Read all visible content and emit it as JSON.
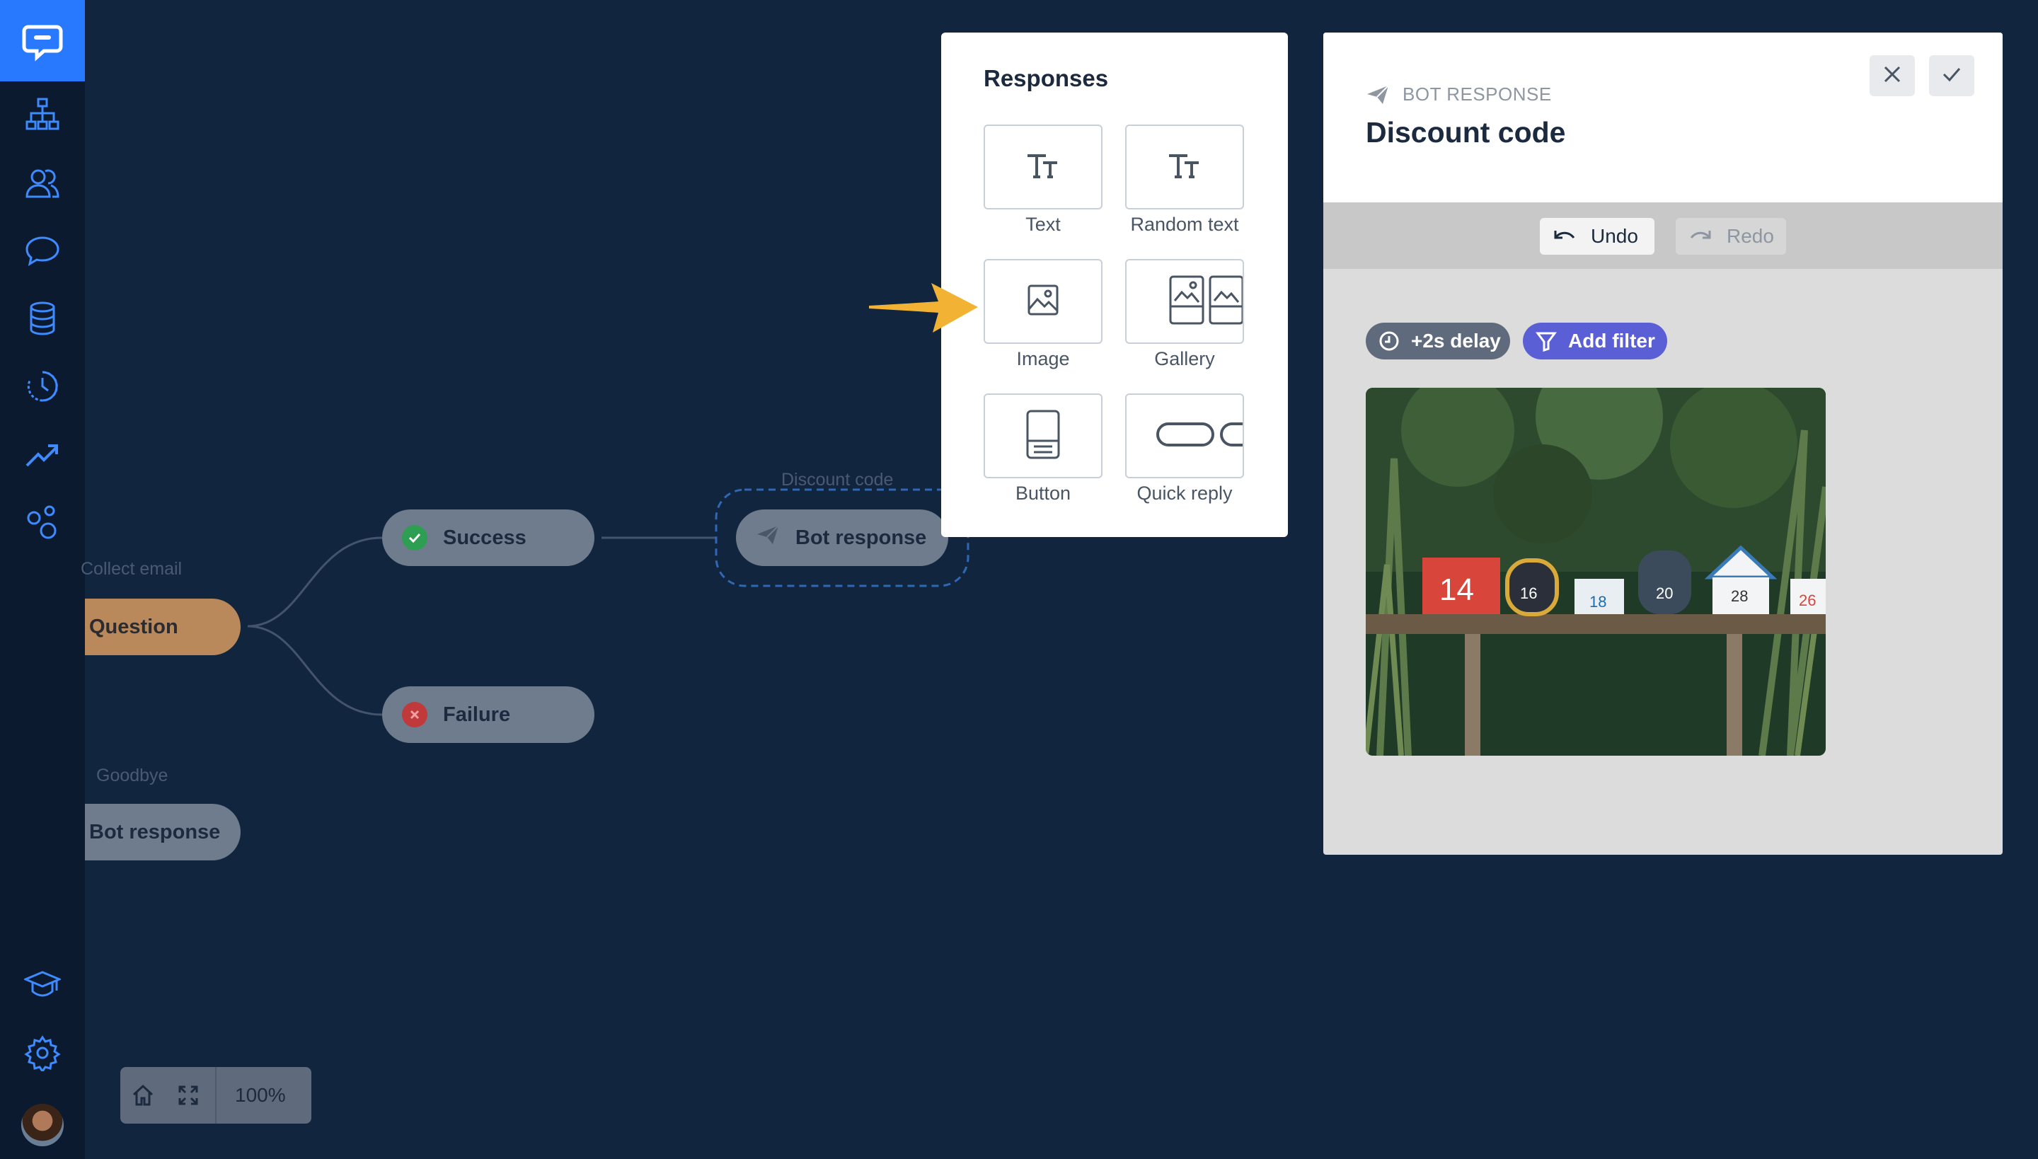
{
  "sidebar": {
    "items": [
      "logo-chat-icon",
      "flow-tree-icon",
      "users-icon",
      "chat-bubble-icon",
      "database-icon",
      "history-icon",
      "analytics-icon",
      "integrations-icon",
      "academy-icon",
      "settings-icon",
      "avatar"
    ]
  },
  "canvas": {
    "node_success": "Success",
    "node_failure": "Failure",
    "label_collect_email": "Collect email",
    "node_question": "Question",
    "label_goodbye": "Goodbye",
    "node_goodbye_bot": "Bot response",
    "label_discount": "Discount code",
    "node_discount_bot": "Bot response"
  },
  "zoom": {
    "value": "100%"
  },
  "responses": {
    "title": "Responses",
    "tiles": [
      {
        "label": "Text",
        "icon": "text-icon"
      },
      {
        "label": "Random text",
        "icon": "random-text-icon"
      },
      {
        "label": "Image",
        "icon": "image-icon"
      },
      {
        "label": "Gallery",
        "icon": "gallery-icon"
      },
      {
        "label": "Button",
        "icon": "button-icon"
      },
      {
        "label": "Quick reply",
        "icon": "quick-reply-icon"
      }
    ]
  },
  "editor": {
    "kind": "BOT RESPONSE",
    "title": "Discount code",
    "undo": "Undo",
    "redo": "Redo",
    "delay": "+2s delay",
    "filter": "Add filter",
    "image_numbers": [
      "14",
      "16",
      "18",
      "20",
      "28",
      "26"
    ]
  },
  "colors": {
    "rail": "#0c1a2f",
    "logo": "#2979ff",
    "canvas": "#12253f",
    "success": "#2e9e52",
    "failure": "#d9534f",
    "question": "#c68a52",
    "accent_purple": "#5b5fd6",
    "delay_chip": "#5f6b7c",
    "arrow": "#f2b233"
  }
}
